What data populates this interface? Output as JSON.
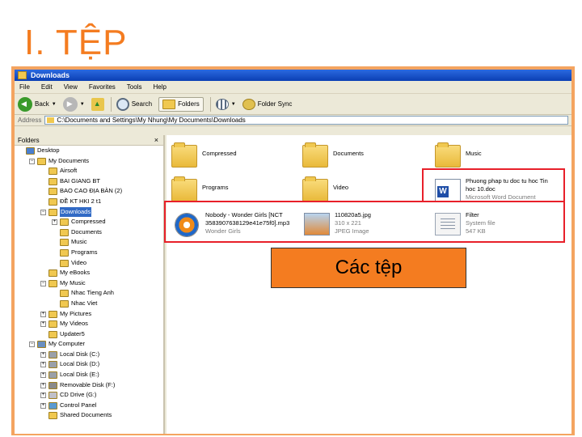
{
  "slide": {
    "title": "I. TỆP",
    "callout": "Các tệp"
  },
  "window": {
    "title": "Downloads",
    "menu": [
      "File",
      "Edit",
      "View",
      "Favorites",
      "Tools",
      "Help"
    ],
    "toolbar": {
      "back": "Back",
      "search": "Search",
      "folders": "Folders",
      "folder_sync": "Folder Sync"
    },
    "address": {
      "label": "Address",
      "value": "C:\\Documents and Settings\\My Nhung\\My Documents\\Downloads"
    },
    "folders_pane": {
      "title": "Folders",
      "close": "×",
      "items": [
        {
          "label": "Desktop",
          "indent": 0,
          "icon": "desktop-icon",
          "expander": ""
        },
        {
          "label": "My Documents",
          "indent": 1,
          "icon": "folder-icon",
          "expander": "−"
        },
        {
          "label": "Airsoft",
          "indent": 2,
          "icon": "folder-icon",
          "expander": ""
        },
        {
          "label": "BAI GIANG BT",
          "indent": 2,
          "icon": "folder-icon",
          "expander": ""
        },
        {
          "label": "BAO CAO ĐỊA BÀN (2)",
          "indent": 2,
          "icon": "folder-icon",
          "expander": ""
        },
        {
          "label": "ĐỀ KT HKI 2 t1",
          "indent": 2,
          "icon": "folder-icon",
          "expander": ""
        },
        {
          "label": "Downloads",
          "indent": 2,
          "icon": "folder-icon",
          "expander": "−",
          "selected": true
        },
        {
          "label": "Compressed",
          "indent": 3,
          "icon": "folder-icon",
          "expander": "+"
        },
        {
          "label": "Documents",
          "indent": 3,
          "icon": "folder-icon",
          "expander": ""
        },
        {
          "label": "Music",
          "indent": 3,
          "icon": "folder-icon",
          "expander": ""
        },
        {
          "label": "Programs",
          "indent": 3,
          "icon": "folder-icon",
          "expander": ""
        },
        {
          "label": "Video",
          "indent": 3,
          "icon": "folder-icon",
          "expander": ""
        },
        {
          "label": "My eBooks",
          "indent": 2,
          "icon": "folder-icon",
          "expander": ""
        },
        {
          "label": "My Music",
          "indent": 2,
          "icon": "music-folder-icon",
          "expander": "−"
        },
        {
          "label": "Nhac Tieng Anh",
          "indent": 3,
          "icon": "folder-icon",
          "expander": ""
        },
        {
          "label": "Nhac Viet",
          "indent": 3,
          "icon": "folder-icon",
          "expander": ""
        },
        {
          "label": "My Pictures",
          "indent": 2,
          "icon": "pictures-folder-icon",
          "expander": "+"
        },
        {
          "label": "My Videos",
          "indent": 2,
          "icon": "videos-folder-icon",
          "expander": "+"
        },
        {
          "label": "Updater5",
          "indent": 2,
          "icon": "folder-icon",
          "expander": ""
        },
        {
          "label": "My Computer",
          "indent": 1,
          "icon": "computer-icon",
          "expander": "−"
        },
        {
          "label": "Local Disk (C:)",
          "indent": 2,
          "icon": "disk-icon",
          "expander": "+"
        },
        {
          "label": "Local Disk (D:)",
          "indent": 2,
          "icon": "disk-icon",
          "expander": "+"
        },
        {
          "label": "Local Disk (E:)",
          "indent": 2,
          "icon": "disk-icon",
          "expander": "+"
        },
        {
          "label": "Removable Disk (F:)",
          "indent": 2,
          "icon": "removable-disk-icon",
          "expander": "+"
        },
        {
          "label": "CD Drive (G:)",
          "indent": 2,
          "icon": "cd-drive-icon",
          "expander": "+"
        },
        {
          "label": "Control Panel",
          "indent": 2,
          "icon": "control-panel-icon",
          "expander": "+"
        },
        {
          "label": "Shared Documents",
          "indent": 2,
          "icon": "folder-icon",
          "expander": ""
        }
      ]
    },
    "files": [
      {
        "name": "Compressed",
        "icon": "folder-icon",
        "meta1": "",
        "meta2": ""
      },
      {
        "name": "Documents",
        "icon": "folder-icon",
        "meta1": "",
        "meta2": ""
      },
      {
        "name": "Music",
        "icon": "folder-icon",
        "meta1": "",
        "meta2": ""
      },
      {
        "name": "Programs",
        "icon": "folder-icon",
        "meta1": "",
        "meta2": ""
      },
      {
        "name": "Video",
        "icon": "folder-icon",
        "meta1": "",
        "meta2": ""
      },
      {
        "name": "Phuong phap tu doc tu hoc Tin",
        "icon": "word-doc-icon",
        "meta1": "hoc 10.doc",
        "meta2": "Microsoft Word Document"
      },
      {
        "name": "Nobody - Wonder Girls [NCT",
        "icon": "media-player-icon",
        "meta1": "3583907638129e41e75f0].mp3",
        "meta2": "Wonder Girls"
      },
      {
        "name": "110820a5.jpg",
        "icon": "jpeg-image-icon",
        "meta1": "310 x 221",
        "meta2": "JPEG Image"
      },
      {
        "name": "Filter",
        "icon": "system-file-icon",
        "meta1": "System file",
        "meta2": "547 KB"
      }
    ]
  },
  "colors": {
    "accent": "#f47c20",
    "highlight": "#e8202a",
    "selection": "#316ac5"
  }
}
